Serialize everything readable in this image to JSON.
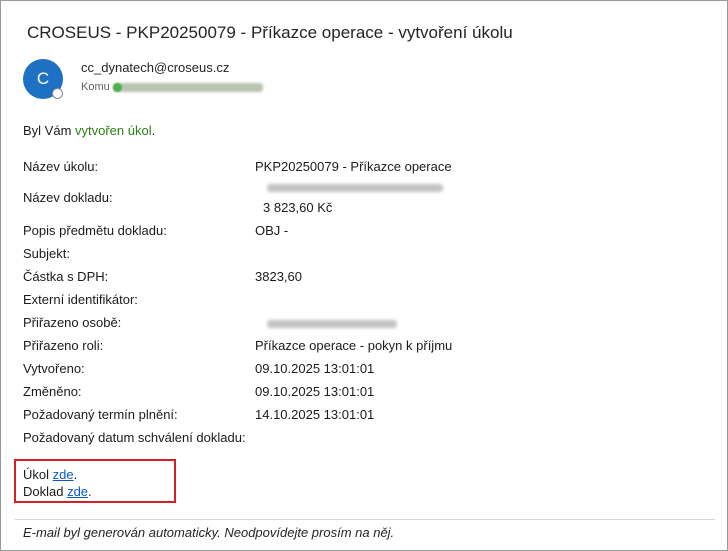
{
  "email": {
    "subject": "CROSEUS - PKP20250079 - Příkazce operace - vytvoření úkolu",
    "sender_initial": "C",
    "sender": "cc_dynatech@croseus.cz",
    "to_label": "Komu",
    "intro_prefix": "Byl Vám ",
    "intro_link": "vytvořen úkol",
    "intro_suffix": "."
  },
  "fields": [
    {
      "label": "Název úkolu:",
      "value": "PKP20250079 - Příkazce operace"
    },
    {
      "label": "Název dokladu:",
      "value": "3 823,60 Kč"
    },
    {
      "label": "Popis předmětu dokladu:",
      "value": "OBJ - "
    },
    {
      "label": "Subjekt:",
      "value": ""
    },
    {
      "label": "Částka s DPH:",
      "value": "3823,60"
    },
    {
      "label": "Externí identifikátor:",
      "value": ""
    },
    {
      "label": "Přiřazeno osobě:",
      "value": ""
    },
    {
      "label": "Přiřazeno roli:",
      "value": "Příkazce operace - pokyn k příjmu"
    },
    {
      "label": "Vytvořeno:",
      "value": "09.10.2025 13:01:01"
    },
    {
      "label": "Změněno:",
      "value": "09.10.2025 13:01:01"
    },
    {
      "label": "Požadovaný termín plnění:",
      "value": "14.10.2025 13:01:01"
    },
    {
      "label": "Požadovaný datum schválení dokladu:",
      "value": ""
    }
  ],
  "links": {
    "task_prefix": "Úkol ",
    "task_link": "zde",
    "task_suffix": ".",
    "doc_prefix": "Doklad ",
    "doc_link": "zde",
    "doc_suffix": "."
  },
  "footer": "E-mail byl generován automaticky. Neodpovídejte prosím na něj."
}
